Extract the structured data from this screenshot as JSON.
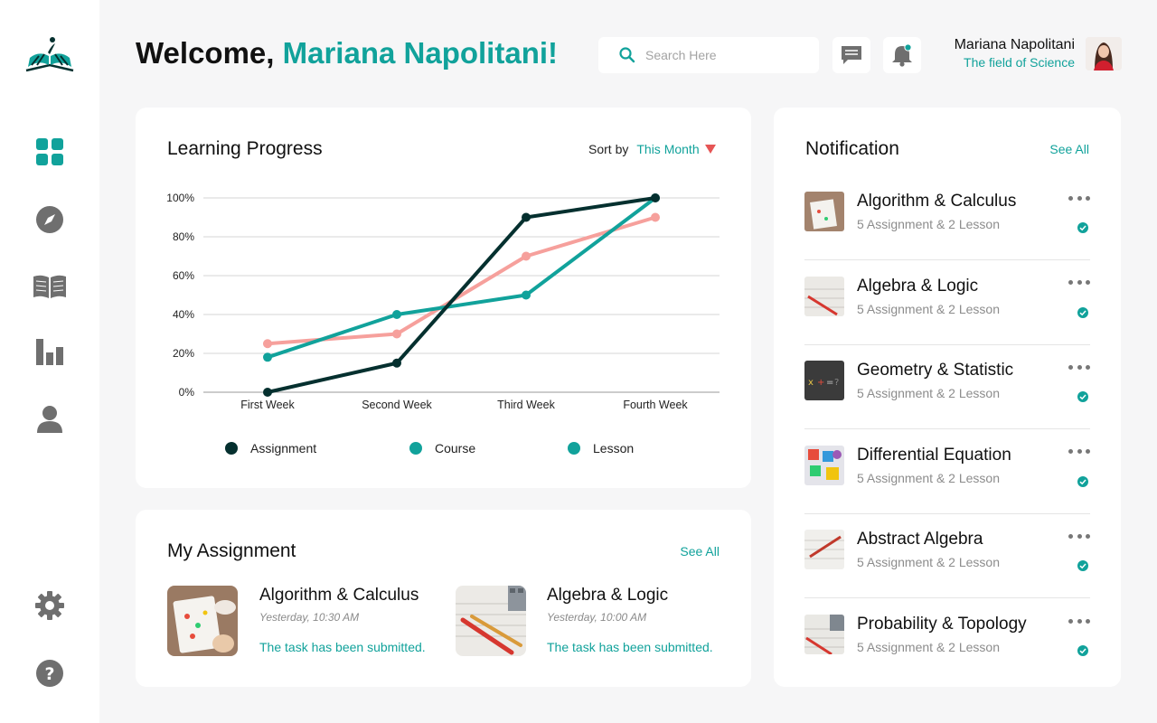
{
  "header": {
    "welcome_prefix": "Welcome,",
    "user_first_name": "Mariana Napolitani!",
    "search_placeholder": "Search Here",
    "user_name": "Mariana Napolitani",
    "user_field": "The field of Science"
  },
  "sidebar": {
    "icons": [
      "grid-icon",
      "compass-icon",
      "book-icon",
      "bar-chart-icon",
      "user-icon",
      "gear-icon",
      "help-icon"
    ]
  },
  "progress": {
    "title": "Learning Progress",
    "sort_label": "Sort by",
    "sort_value": "This Month"
  },
  "chart_data": {
    "type": "line",
    "categories": [
      "First Week",
      "Second Week",
      "Third Week",
      "Fourth Week"
    ],
    "y_ticks": [
      "100%",
      "80%",
      "60%",
      "40%",
      "20%",
      "0%"
    ],
    "ylim": [
      0,
      100
    ],
    "grid": true,
    "legend_placement": "bottom",
    "series": [
      {
        "name": "Assignment",
        "color": "#05302f",
        "values": [
          0,
          15,
          90,
          100
        ]
      },
      {
        "name": "Course",
        "color": "#f6a09c",
        "values": [
          25,
          30,
          70,
          90
        ]
      },
      {
        "name": "Lesson",
        "color": "#11a29b",
        "values": [
          18,
          40,
          50,
          100
        ]
      }
    ],
    "legend_colors": [
      "#05302f",
      "#11a29b",
      "#11a29b"
    ]
  },
  "assignments": {
    "title": "My Assignment",
    "see_all": "See All",
    "items": [
      {
        "title": "Algorithm & Calculus",
        "time": "Yesterday, 10:30 AM",
        "status": "The task has been submitted."
      },
      {
        "title": "Algebra & Logic",
        "time": "Yesterday, 10:00 AM",
        "status": "The task has been submitted."
      }
    ]
  },
  "notifications": {
    "title": "Notification",
    "see_all": "See All",
    "items": [
      {
        "title": "Algorithm & Calculus",
        "subtitle": "5 Assignment & 2 Lesson"
      },
      {
        "title": "Algebra & Logic",
        "subtitle": "5 Assignment & 2 Lesson"
      },
      {
        "title": "Geometry & Statistic",
        "subtitle": "5 Assignment & 2 Lesson"
      },
      {
        "title": "Differential Equation",
        "subtitle": "5 Assignment & 2 Lesson"
      },
      {
        "title": "Abstract Algebra",
        "subtitle": "5 Assignment & 2 Lesson"
      },
      {
        "title": "Probability & Topology",
        "subtitle": "5 Assignment & 2 Lesson"
      }
    ]
  },
  "colors": {
    "accent": "#11a29b",
    "dark": "#05302f",
    "salmon": "#f6a09c",
    "icon_gray": "#6f6f6f"
  }
}
